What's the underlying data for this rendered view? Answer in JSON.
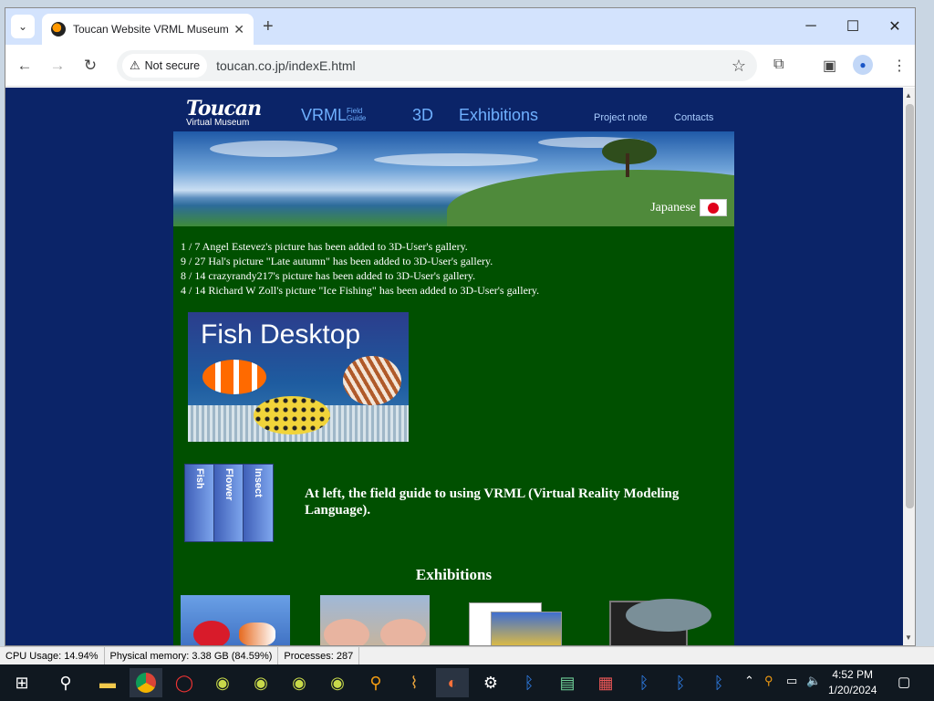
{
  "browser": {
    "tab_title": "Toucan Website VRML Museum",
    "new_tab_symbol": "+",
    "security_label": "Not secure",
    "url": "toucan.co.jp/indexE.html"
  },
  "site": {
    "logo_brand": "Toucan",
    "logo_sub": "Virtual Museum",
    "nav": {
      "vrml": "VRML",
      "vrml_sup_1": "Field",
      "vrml_sup_2": "Guide",
      "three_d": "3D",
      "exhibitions": "Exhibitions",
      "project_note": "Project note",
      "contacts": "Contacts"
    },
    "language_link": "Japanese",
    "news": [
      "1 / 7 Angel Estevez's picture has been added to 3D-User's gallery.",
      "9 / 27 Hal's picture \"Late autumn\" has been added to 3D-User's gallery.",
      "8 / 14 crazyrandy217's picture has been added to 3D-User's gallery.",
      "4 / 14 Richard W Zoll's picture \"Ice Fishing\" has been added to 3D-User's gallery."
    ],
    "fish_banner_title": "Fish Desktop",
    "guide_books": [
      "Fish",
      "Flower",
      "Insect"
    ],
    "guide_text": "At left, the field guide to using VRML (Virtual Reality Modeling Language).",
    "exhibitions_heading": "Exhibitions"
  },
  "statusbar": {
    "cpu": "CPU Usage: 14.94%",
    "memory": "Physical memory: 3.38 GB (84.59%)",
    "processes": "Processes: 287"
  },
  "taskbar": {
    "time": "4:52 PM",
    "date": "1/20/2024"
  },
  "colors": {
    "page_bg": "#0b2468",
    "content_bg": "#005000",
    "nav_link": "#6fb0ff"
  }
}
